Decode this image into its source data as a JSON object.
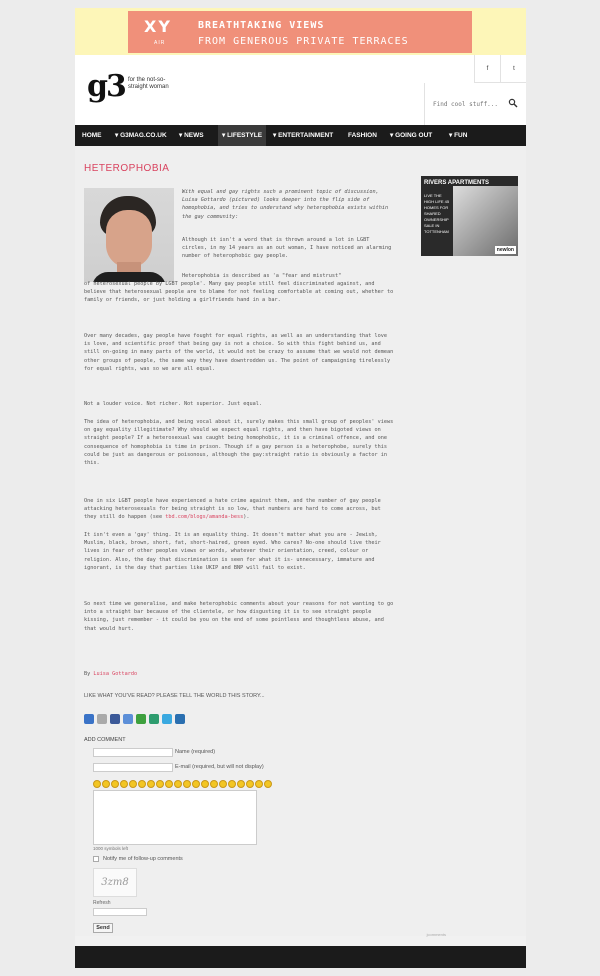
{
  "banner": {
    "logo": "XY",
    "logo_sub": "AIR",
    "line1": "BREATHTAKING VIEWS",
    "line2": "FROM GENEROUS PRIVATE TERRACES"
  },
  "header": {
    "logo": "g3",
    "tagline": "for the not-so-straight woman",
    "social": [
      "f",
      "t"
    ],
    "search_placeholder": "Find cool stuff..."
  },
  "nav": {
    "items": [
      {
        "label": "HOME"
      },
      {
        "label": "▾ G3MAG.CO.UK"
      },
      {
        "label": "▾ NEWS"
      },
      {
        "label": "▾ LIFESTYLE"
      },
      {
        "label": "▾ ENTERTAINMENT"
      },
      {
        "label": "FASHION"
      },
      {
        "label": "▾ GOING OUT"
      },
      {
        "label": "▾ FUN"
      }
    ]
  },
  "article": {
    "title": "HETEROPHOBIA",
    "intro": "With equal and gay rights such a prominent topic of discussion, Luisa Gottardo (pictured) looks deeper into the flip side of homophobia, and tries to understand why heterophobia exists within the gay community:",
    "p1": "Although it isn't a word that is thrown around a lot in LGBT circles, in my 14 years as an out woman, I have noticed an alarming number of heterophobic gay people.",
    "p2a": "Heterophobia is described as 'a \"fear and mistrust\"",
    "p2b": "of heterosexual people by LGBT people'. Many gay people still feel discriminated against, and believe that heterosexual people are to blame for not feeling comfortable at coming out, whether to family or friends, or just holding a girlfriends hand in a bar.",
    "p3": "Over many decades, gay people have fought for equal rights, as well as an understanding that love is love, and scientific proof that being gay is not a choice. So with this fight behind us, and still on-going in many parts of the world, it would not be crazy to assume that we would not demean other groups of people, the same way they have downtrodden us. The point of campaigning tirelessly for equal rights, was so we are all equal.",
    "p4": "Not a louder voice. Not richer. Not superior. Just equal.",
    "p5": "The idea of heterophobia, and being vocal about it, surely makes this small group of peoples' views on gay equality illegitimate? Why should we expect equal rights, and then have bigoted views on straight people? If a heterosexual was caught being homophobic, it is a criminal offence, and one consequence of homophobia is time in prison. Though if a gay person is a heterophobe, surely this could be just as dangerous or poisonous, although the gay:straight ratio is obviously a factor in this.",
    "p6a": "One in six LGBT people have experienced a hate crime against them, and the number of gay people attacking heterosexuals for being straight is so low, that numbers are hard to come across, but they still do happen (see ",
    "p6link": "tbd.com/blogs/amanda-bess",
    "p6b": ").",
    "p7": "It isn't even a 'gay' thing. It is an equality thing. It doesn't matter what you are - Jewish, Muslim, black, brown, short, fat, short-haired, green eyed. Who cares? No-one should live their lives in fear of other peoples views or words, whatever their orientation, creed, colour or religion. Also, the day that discrimination is seen for what it is- unnecessary, immature and ignorant, is the day that parties like UKIP and BNP will fail to exist.",
    "p8": "So next time we generalise, and make heterophobic comments about your reasons for not wanting to go into a straight bar because of the clientele, or how disgusting it is to see straight people kissing, just remember - it could be you on the end of some pointless and thoughtless abuse, and that would hurt.",
    "byline_prefix": "By ",
    "byline_name": "Luisa Gottardo"
  },
  "sidebar_ad": {
    "brand": "RIVERS APARTMENTS",
    "copy": "LIVE THE HIGH LIFE 45 HOMES FOR SHARED OWNERSHIP SALE IN TOTTENHAM",
    "partner": "newlon"
  },
  "share": {
    "title": "LIKE WHAT YOU'VE READ? PLEASE TELL THE WORLD THIS STORY...",
    "icons": [
      "delicious-icon",
      "digg-icon",
      "facebook-icon",
      "google-icon",
      "stumbleupon-icon",
      "reddit-icon",
      "twitter-icon",
      "linkedin-icon"
    ]
  },
  "comment": {
    "heading": "ADD COMMENT",
    "name_label": "Name (required)",
    "email_label": "E-mail (required, but will not display)",
    "counter": "1000 symbols left",
    "notify": "Notify me of follow-up comments",
    "captcha_text": "3zm8",
    "refresh": "Refresh",
    "send": "Send",
    "credit": "jcomments"
  },
  "colors": {
    "accent": "#d9435f",
    "nav_bg": "#1b1b1b",
    "banner_bg": "#f0907a",
    "banner_strip": "#fdf6b8"
  }
}
